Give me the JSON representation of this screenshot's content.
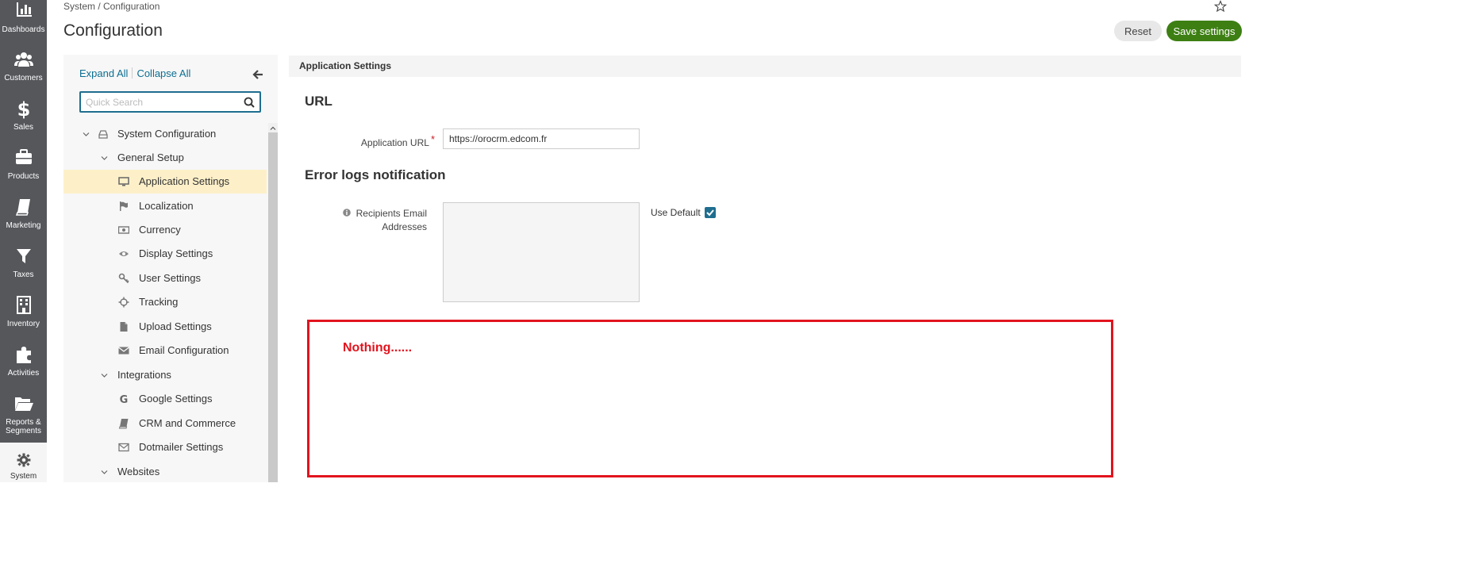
{
  "nav": {
    "items": [
      {
        "label": "Dashboards",
        "icon": "bar-chart-icon"
      },
      {
        "label": "Customers",
        "icon": "users-icon"
      },
      {
        "label": "Sales",
        "icon": "dollar-icon"
      },
      {
        "label": "Products",
        "icon": "briefcase-icon"
      },
      {
        "label": "Marketing",
        "icon": "book-icon"
      },
      {
        "label": "Taxes",
        "icon": "filter-icon"
      },
      {
        "label": "Inventory",
        "icon": "building-icon"
      },
      {
        "label": "Activities",
        "icon": "puzzle-icon"
      },
      {
        "label": "Reports &",
        "label2": "Segments",
        "icon": "folder-open-icon"
      },
      {
        "label": "System",
        "icon": "gear-icon"
      }
    ]
  },
  "header": {
    "breadcrumb": "System / Configuration",
    "title": "Configuration",
    "reset_label": "Reset",
    "save_label": "Save settings"
  },
  "sidebar": {
    "expand_all": "Expand All",
    "collapse_all": "Collapse All",
    "search_placeholder": "Quick Search",
    "tree": [
      {
        "label": "System Configuration",
        "level": 0,
        "icon": "hdd-icon"
      },
      {
        "label": "General Setup",
        "level": 1
      },
      {
        "label": "Application Settings",
        "level": 2,
        "icon": "monitor-icon",
        "active": true
      },
      {
        "label": "Localization",
        "level": 2,
        "icon": "flag-icon"
      },
      {
        "label": "Currency",
        "level": 2,
        "icon": "money-icon"
      },
      {
        "label": "Display Settings",
        "level": 2,
        "icon": "eye-icon"
      },
      {
        "label": "User Settings",
        "level": 2,
        "icon": "key-icon"
      },
      {
        "label": "Tracking",
        "level": 2,
        "icon": "crosshairs-icon"
      },
      {
        "label": "Upload Settings",
        "level": 2,
        "icon": "file-icon"
      },
      {
        "label": "Email Configuration",
        "level": 2,
        "icon": "envelope-icon"
      },
      {
        "label": "Integrations",
        "level": 1
      },
      {
        "label": "Google Settings",
        "level": 2,
        "icon": "google-icon"
      },
      {
        "label": "CRM and Commerce",
        "level": 2,
        "icon": "book-icon"
      },
      {
        "label": "Dotmailer Settings",
        "level": 2,
        "icon": "envelope-outline-icon"
      },
      {
        "label": "Websites",
        "level": 1
      }
    ]
  },
  "main": {
    "header": "Application Settings",
    "url_section": {
      "title": "URL",
      "app_url_label": "Application URL",
      "app_url_value": "https://orocrm.edcom.fr"
    },
    "error_section": {
      "title": "Error logs notification",
      "recipients_label_1": "Recipients Email",
      "recipients_label_2": "Addresses",
      "use_default_label": "Use Default",
      "use_default_checked": true
    },
    "annotation": "Nothing......"
  },
  "colors": {
    "nav_bg": "#55575b",
    "accent": "#1f6e8f",
    "save_green": "#3d7f13",
    "annotation_red": "#e2141e",
    "active_row": "#fdf0c9"
  }
}
